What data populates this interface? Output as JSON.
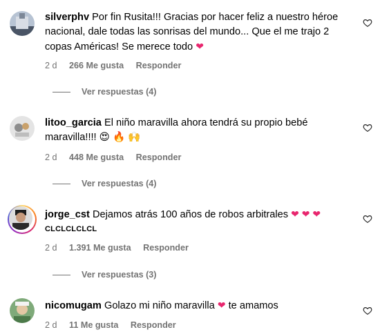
{
  "comments": [
    {
      "username": "silverphv",
      "text": "Por fin Rusita!!! Gracias por hacer feliz a nuestro héroe nacional, dale todas las sonrisas del mundo... Que el me trajo 2 copas Américas! Se merece todo",
      "emoji": "❤",
      "time": "2 d",
      "likes": "266 Me gusta",
      "reply": "Responder",
      "view_replies": "Ver respuestas (4)"
    },
    {
      "username": "litoo_garcia",
      "text": "El niño maravilla ahora tendrá su propio bebé maravilla!!!!",
      "emoji": "😍 🔥 🙌",
      "time": "2 d",
      "likes": "448 Me gusta",
      "reply": "Responder",
      "view_replies": "Ver respuestas (4)"
    },
    {
      "username": "jorge_cst",
      "text": "Dejamos atrás 100 años de robos arbitrales",
      "emoji": "❤ ❤ ❤",
      "extra_line": "CLCLCLCLCL",
      "time": "2 d",
      "likes": "1.391 Me gusta",
      "reply": "Responder",
      "view_replies": "Ver respuestas (3)"
    },
    {
      "username": "nicomugam",
      "text": "Golazo mi niño maravilla",
      "emoji": "❤",
      "text_after": "te amamos",
      "time": "2 d",
      "likes": "11 Me gusta",
      "reply": "Responder"
    }
  ]
}
